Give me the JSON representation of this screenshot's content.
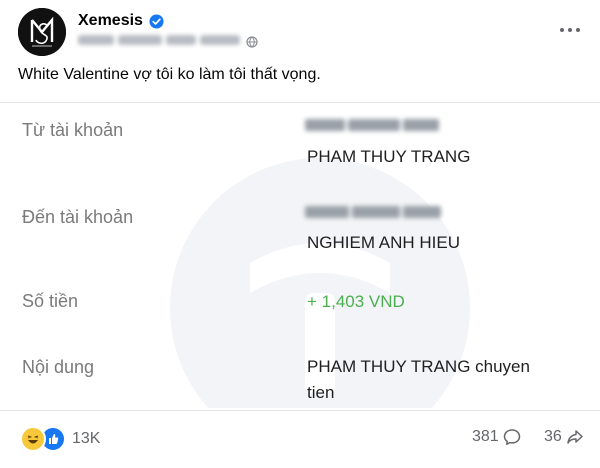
{
  "post": {
    "author": "Xemesis",
    "caption": "White Valentine vợ tôi ko làm tôi thất vọng."
  },
  "transfer": {
    "from_label": "Từ tài khoản",
    "from_name": "PHAM THUY TRANG",
    "to_label": "Đến tài khoản",
    "to_name": "NGHIEM ANH HIEU",
    "amount_label": "Số tiền",
    "amount_value": "+ 1,403 VND",
    "note_label": "Nội dung",
    "note_line1": "PHAM THUY TRANG chuyen",
    "note_line2": "tien"
  },
  "footer": {
    "reaction_count": "13K",
    "comment_count": "381",
    "share_count": "36"
  },
  "colors": {
    "amount": "#4caf50",
    "verified": "#1877f2",
    "label": "#7a7a7a"
  },
  "icons": {
    "verified": "verified-badge-icon",
    "more": "more-dots-icon",
    "comment": "comment-icon",
    "share": "share-icon",
    "haha": "haha-reaction-icon",
    "like": "like-reaction-icon"
  }
}
